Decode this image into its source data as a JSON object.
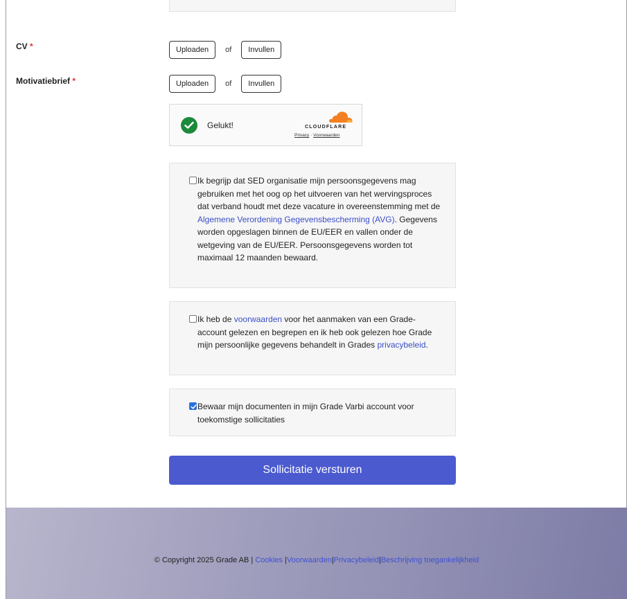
{
  "form": {
    "cv": {
      "label": "CV",
      "required_mark": "*",
      "upload_label": "Uploaden",
      "or_label": "of",
      "fill_label": "Invullen"
    },
    "motivation": {
      "label": "Motivatiebrief",
      "required_mark": "*",
      "upload_label": "Uploaden",
      "or_label": "of",
      "fill_label": "Invullen"
    }
  },
  "captcha": {
    "status": "Gelukt!",
    "brand": "CLOUDFLARE",
    "privacy_link": "Privacy",
    "separator": "·",
    "terms_link": "Voorwaarden",
    "colors": {
      "success": "#1b8a3b",
      "brand_orange": "#f38020"
    }
  },
  "consents": [
    {
      "checked": false,
      "text_1": "Ik begrijp dat SED organisatie mijn persoonsgegevens mag gebruiken met het oog op het uitvoeren van het wervingsproces dat verband houdt met deze vacature in overeenstemming met de ",
      "link": "Algemene Verordening Gegevensbescherming (AVG)",
      "text_2": ". Gegevens worden opgeslagen binnen de EU/EER en vallen onder de wetgeving van de EU/EER. Persoonsgegevens worden tot maximaal 12 maanden bewaard."
    },
    {
      "checked": false,
      "text_1": "Ik heb de ",
      "link_1": "voorwaarden",
      "text_2": " voor het aanmaken van een Grade-account gelezen en begrepen en ik heb ook gelezen hoe Grade mijn persoonlijke gegevens behandelt in Grades ",
      "link_2": "privacybeleid",
      "text_3": "."
    },
    {
      "checked": true,
      "text_1": "Bewaar mijn documenten in mijn Grade Varbi account voor toekomstige sollicitaties"
    }
  ],
  "submit_label": "Sollicitatie versturen",
  "footer": {
    "copyright": "© Copyright 2025 Grade AB",
    "sep": "|",
    "cookies": "Cookies",
    "terms": "Voorwaarden",
    "privacy": "Privacybeleid",
    "accessibility": "Beschrijving toegankelijkheid"
  },
  "colors": {
    "accent": "#4b5acf",
    "link": "#3b4fc8",
    "required": "#e03131",
    "checkbox_checked": "#2b6fdc"
  },
  "icons": {
    "captcha_success": "check-circle-icon",
    "captcha_brand": "cloudflare-cloud-icon",
    "checkbox_tick": "check-icon"
  }
}
